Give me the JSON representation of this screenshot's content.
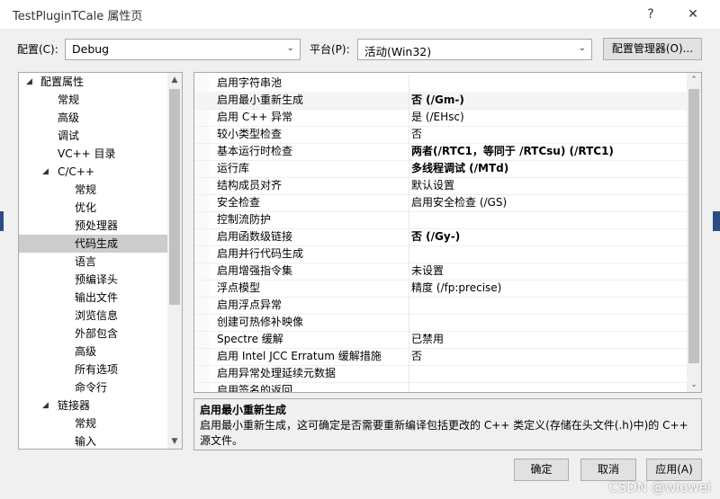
{
  "window": {
    "title": "TestPluginTCale 属性页",
    "help_label": "?",
    "close_label": "✕"
  },
  "config": {
    "label": "配置(C):",
    "value": "Debug",
    "platform_label": "平台(P):",
    "platform_value": "活动(Win32)",
    "manager_label": "配置管理器(O)..."
  },
  "tree": {
    "items": [
      {
        "label": "配置属性",
        "expanded": true
      },
      {
        "label": "常规"
      },
      {
        "label": "高级"
      },
      {
        "label": "调试"
      },
      {
        "label": "VC++ 目录"
      },
      {
        "label": "C/C++",
        "expanded": true
      },
      {
        "label": "常规"
      },
      {
        "label": "优化"
      },
      {
        "label": "预处理器"
      },
      {
        "label": "代码生成",
        "selected": true
      },
      {
        "label": "语言"
      },
      {
        "label": "预编译头"
      },
      {
        "label": "输出文件"
      },
      {
        "label": "浏览信息"
      },
      {
        "label": "外部包含"
      },
      {
        "label": "高级"
      },
      {
        "label": "所有选项"
      },
      {
        "label": "命令行"
      },
      {
        "label": "链接器",
        "expanded": true
      },
      {
        "label": "常规"
      },
      {
        "label": "输入"
      }
    ]
  },
  "grid": {
    "rows": [
      {
        "name": "启用字符串池",
        "value": ""
      },
      {
        "name": "启用最小重新生成",
        "value": "否 (/Gm-)",
        "bold": true,
        "selected": true
      },
      {
        "name": "启用 C++ 异常",
        "value": "是 (/EHsc)"
      },
      {
        "name": "较小类型检查",
        "value": "否"
      },
      {
        "name": "基本运行时检查",
        "value": "两者(/RTC1，等同于 /RTCsu) (/RTC1)",
        "bold": true
      },
      {
        "name": "运行库",
        "value": "多线程调试 (/MTd)",
        "bold": true
      },
      {
        "name": "结构成员对齐",
        "value": "默认设置"
      },
      {
        "name": "安全检查",
        "value": "启用安全检查 (/GS)"
      },
      {
        "name": "控制流防护",
        "value": ""
      },
      {
        "name": "启用函数级链接",
        "value": "否 (/Gy-)",
        "bold": true
      },
      {
        "name": "启用并行代码生成",
        "value": ""
      },
      {
        "name": "启用增强指令集",
        "value": "未设置"
      },
      {
        "name": "浮点模型",
        "value": "精度 (/fp:precise)"
      },
      {
        "name": "启用浮点异常",
        "value": ""
      },
      {
        "name": "创建可热修补映像",
        "value": ""
      },
      {
        "name": "Spectre 缓解",
        "value": "已禁用"
      },
      {
        "name": "启用 Intel JCC Erratum 缓解措施",
        "value": "否"
      },
      {
        "name": "启用异常处理延续元数据",
        "value": ""
      },
      {
        "name": "启用签名的返回",
        "value": ""
      }
    ]
  },
  "description": {
    "title": "启用最小重新生成",
    "body": "启用最小重新生成，这可确定是否需要重新编译包括更改的 C++ 类定义(存储在头文件(.h)中)的 C++ 源文件。"
  },
  "buttons": {
    "ok": "确定",
    "cancel": "取消",
    "apply": "应用(A)"
  },
  "watermark": "CSDN @wiowei",
  "icons": {
    "dropdown": "chevron-down-icon",
    "expand": "triangle-expanded-icon",
    "scroll_up": "scroll-up-icon",
    "scroll_down": "scroll-down-icon"
  }
}
